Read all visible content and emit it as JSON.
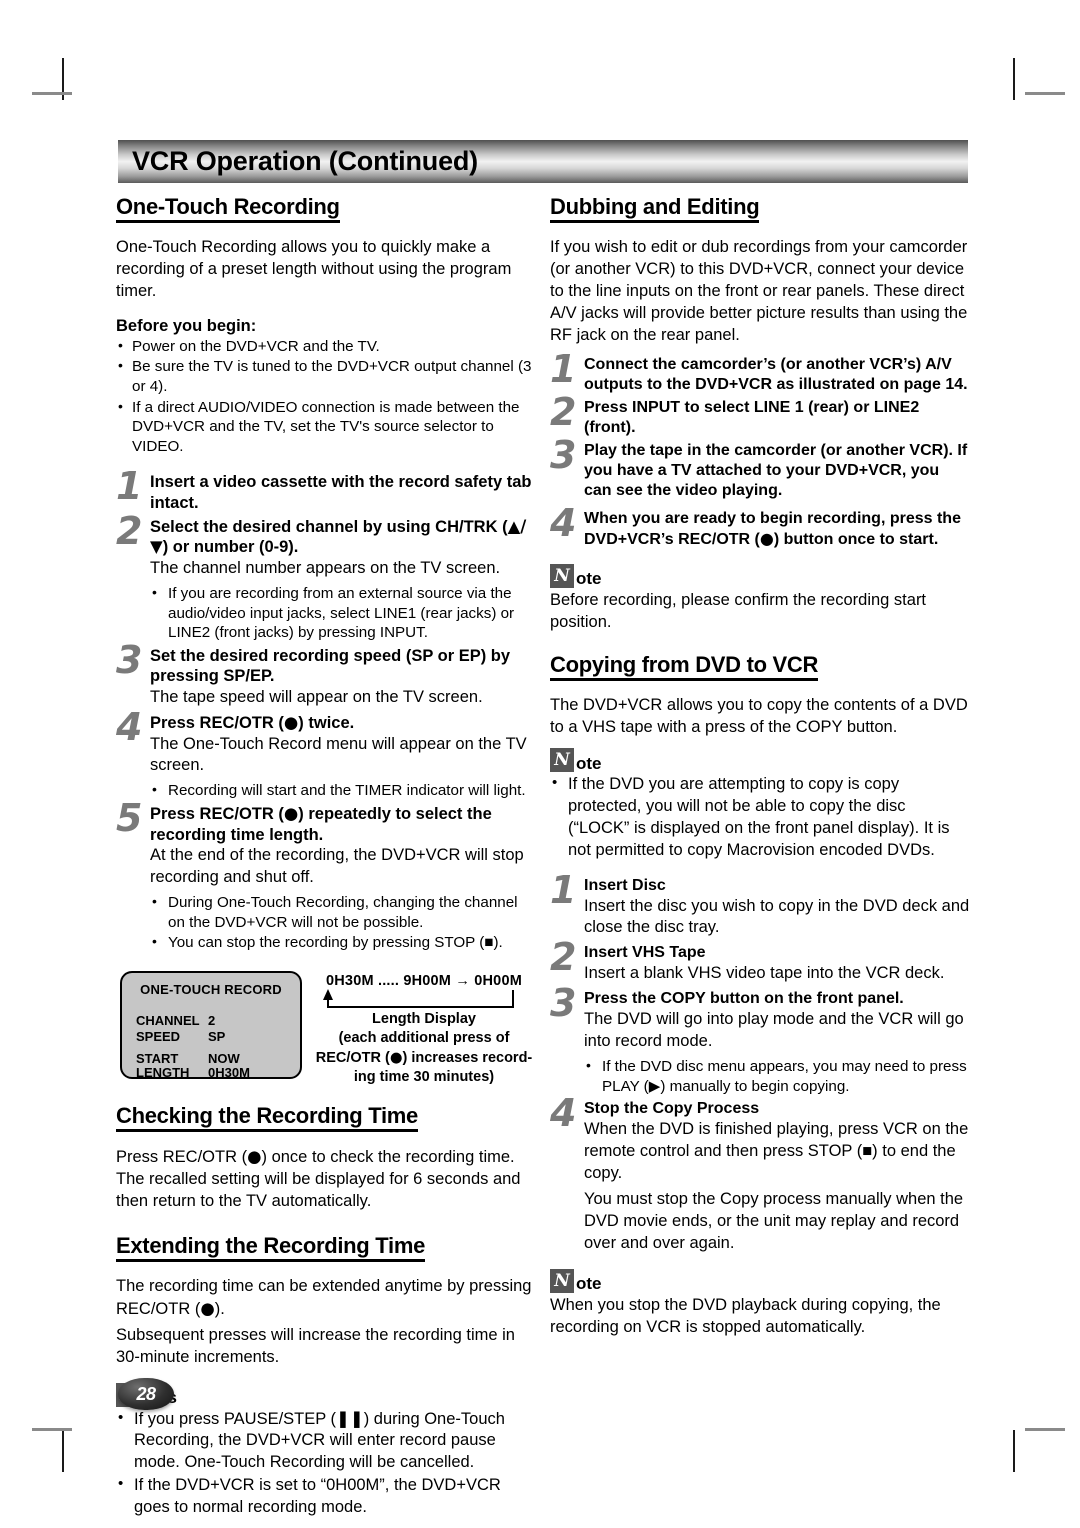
{
  "header": {
    "title": "VCR Operation (Continued)"
  },
  "page_number": "28",
  "left_column": {
    "one_touch": {
      "heading": "One-Touch Recording",
      "intro": "One-Touch Recording allows you to quickly make a recording of a preset length without using the program timer.",
      "before_you_begin_label": "Before you begin:",
      "before_you_begin": [
        "Power on the DVD+VCR and the TV.",
        "Be sure the TV is tuned to the DVD+VCR output channel (3 or 4).",
        "If a direct AUDIO/VIDEO connection is made between the DVD+VCR and the TV, set the TV's source selector to VIDEO."
      ],
      "steps": [
        {
          "num": "1",
          "lead": "Insert a video cassette with the record safety tab intact.",
          "body": "",
          "bullets": []
        },
        {
          "num": "2",
          "lead_pre": "Select the desired channel by using CH/TRK (",
          "lead_symbols": "▲/▼",
          "lead_post": ") or number (0-9).",
          "body": "The channel number appears on the TV screen.",
          "bullets": [
            "If you are recording from an external source via the audio/video input jacks, select LINE1 (rear jacks) or LINE2 (front jacks) by pressing INPUT."
          ]
        },
        {
          "num": "3",
          "lead": "Set the desired recording speed (SP or EP) by pressing SP/EP.",
          "body": "The tape speed will appear on the TV screen.",
          "bullets": []
        },
        {
          "num": "4",
          "lead_pre": "Press REC/OTR (",
          "lead_symbols": "●",
          "lead_post": ") twice.",
          "body": "The One-Touch Record menu will appear on the TV screen.",
          "bullets": [
            "Recording will start and the TIMER indicator will light."
          ]
        },
        {
          "num": "5",
          "lead_pre": "Press REC/OTR (",
          "lead_symbols": "●",
          "lead_post": ") repeatedly to select the recording time length.",
          "body": "At the end of the recording, the DVD+VCR will stop recording and shut off.",
          "bullets": [
            "During One-Touch Recording, changing the channel on the DVD+VCR will not be possible.",
            "You can stop the recording by pressing STOP (■)."
          ]
        }
      ]
    },
    "osd": {
      "title": "ONE-TOUCH RECORD",
      "rows": [
        {
          "key": "CHANNEL",
          "value": "2"
        },
        {
          "key": "SPEED",
          "value": "SP"
        },
        {
          "key": "START",
          "value": "NOW"
        },
        {
          "key": "LENGTH",
          "value": "0H30M"
        }
      ],
      "length_display_top": "0H30M  .....  9H00M → 0H00M",
      "length_caption_line1": "Length Display",
      "length_caption_line2": "(each additional press of",
      "length_caption_line3_pre": "REC/OTR (",
      "length_caption_line3_sym": "●",
      "length_caption_line3_post": ") increases record-",
      "length_caption_line4": "ing time 30 minutes)"
    },
    "checking": {
      "heading": "Checking the Recording Time",
      "body_pre": "Press REC/OTR (",
      "body_sym": "●",
      "body_post": ") once to check the recording time. The recalled setting will be displayed for 6 seconds and then return to the TV automatically."
    },
    "extending": {
      "heading": "Extending the Recording Time",
      "body_pre": "The recording time can be extended anytime by pressing REC/OTR (",
      "body_sym": "●",
      "body_post": ").",
      "body2": "Subsequent presses will increase the recording time in 30-minute increments."
    },
    "notes": {
      "icon_letter": "N",
      "word": "otes",
      "items_html": [
        "If you press PAUSE/STEP (❚❚) during One-Touch Recording, the DVD+VCR will enter record pause mode. One-Touch Recording will be cancelled.",
        "If the DVD+VCR is set to “0H00M”, the DVD+VCR goes to normal recording mode."
      ]
    }
  },
  "right_column": {
    "dubbing": {
      "heading": "Dubbing and Editing",
      "intro": "If you wish to edit or dub recordings from your camcorder (or another VCR) to this DVD+VCR, connect your device to the line inputs on the front or rear panels. These direct A/V jacks will provide better picture results than using the RF jack on the rear panel.",
      "steps": [
        {
          "num": "1",
          "lead": "Connect the camcorder’s (or another VCR’s) A/V outputs to the DVD+VCR as illustrated on page 14."
        },
        {
          "num": "2",
          "lead": "Press INPUT to select LINE 1 (rear) or LINE2 (front)."
        },
        {
          "num": "3",
          "lead": "Play the tape in the camcorder (or another VCR). If you have a TV attached to your DVD+VCR, you can see the video playing."
        },
        {
          "num": "4",
          "lead_pre": "When you are ready to begin recording, press the DVD+VCR’s REC/OTR (",
          "lead_symbols": "●",
          "lead_post": ") button once to start."
        }
      ],
      "note": {
        "icon_letter": "N",
        "word": "ote",
        "text": "Before recording, please confirm the recording start position."
      }
    },
    "copying": {
      "heading": "Copying from DVD to VCR",
      "intro": "The DVD+VCR allows you to copy the contents of a DVD to a VHS tape with a press of the COPY button.",
      "note": {
        "icon_letter": "N",
        "word": "ote",
        "items": [
          "If the DVD you are attempting to copy is copy protected, you will not be able to copy the disc (“LOCK” is displayed on the front panel display). It is not permitted to copy Macrovision encoded DVDs."
        ]
      },
      "steps": [
        {
          "num": "1",
          "lead": "Insert Disc",
          "body": "Insert the disc you wish to copy in the DVD deck and close the disc tray.",
          "bullets": []
        },
        {
          "num": "2",
          "lead": "Insert VHS Tape",
          "body": "Insert a blank VHS video tape into the VCR deck.",
          "bullets": []
        },
        {
          "num": "3",
          "lead": "Press the COPY button on the front panel.",
          "body": "The DVD will go into play mode and the VCR will go into record mode.",
          "bullets": [
            "If the DVD disc menu appears, you may need to press PLAY (▶) manually to begin copying."
          ]
        },
        {
          "num": "4",
          "lead": "Stop the Copy Process",
          "body": "When the DVD is finished playing, press VCR on the remote control and then press STOP (■) to end the copy.",
          "body2": "You must stop the Copy process manually when the DVD movie ends, or the unit may replay and record over and over again.",
          "bullets": []
        }
      ],
      "final_note": {
        "icon_letter": "N",
        "word": "ote",
        "text": "When you stop the DVD playback during copying, the recording on VCR is stopped automatically."
      }
    }
  }
}
